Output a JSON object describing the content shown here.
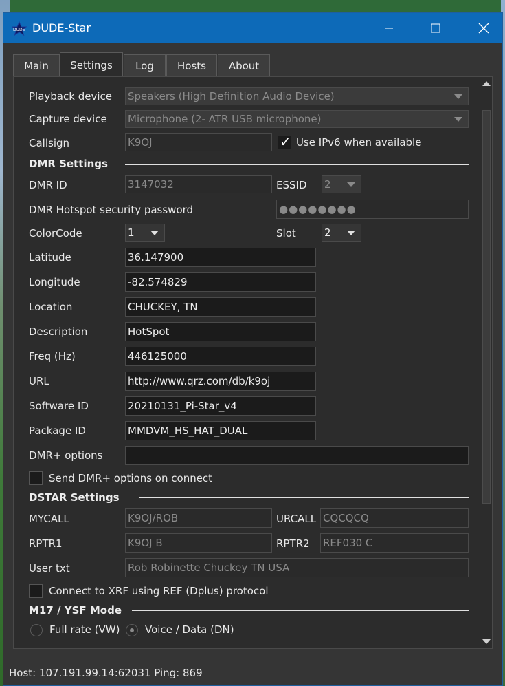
{
  "window": {
    "title": "DUDE-Star",
    "icon": "dude-star-icon"
  },
  "colors": {
    "titlebar": "#0d6ab8",
    "panel": "#2c2c2c",
    "enabled_field": "#1b1b1b"
  },
  "tabs": [
    {
      "label": "Main"
    },
    {
      "label": "Settings",
      "active": true
    },
    {
      "label": "Log"
    },
    {
      "label": "Hosts"
    },
    {
      "label": "About"
    }
  ],
  "settings": {
    "playback_label": "Playback device",
    "playback_value": "Speakers (High Definition Audio Device)",
    "capture_label": "Capture device",
    "capture_value": "Microphone (2- ATR USB microphone)",
    "callsign_label": "Callsign",
    "callsign_value": "K9OJ",
    "ipv6_label": "Use IPv6 when available",
    "ipv6_checked": true
  },
  "dmr": {
    "section": "DMR Settings",
    "id_label": "DMR ID",
    "id_value": "3147032",
    "essid_label": "ESSID",
    "essid_value": "2",
    "password_label": "DMR Hotspot security password",
    "password_value": "●●●●●●●●",
    "colorcode_label": "ColorCode",
    "colorcode_value": "1",
    "slot_label": "Slot",
    "slot_value": "2",
    "latitude_label": "Latitude",
    "latitude_value": "36.147900",
    "longitude_label": "Longitude",
    "longitude_value": "-82.574829",
    "location_label": "Location",
    "location_value": "CHUCKEY, TN",
    "description_label": "Description",
    "description_value": "HotSpot",
    "freq_label": "Freq (Hz)",
    "freq_value": "446125000",
    "url_label": "URL",
    "url_value": "http://www.qrz.com/db/k9oj",
    "software_label": "Software ID",
    "software_value": "20210131_Pi-Star_v4",
    "package_label": "Package ID",
    "package_value": "MMDVM_HS_HAT_DUAL",
    "options_label": "DMR+ options",
    "options_value": "",
    "send_options_label": "Send DMR+ options on connect",
    "send_options_checked": false
  },
  "dstar": {
    "section": "DSTAR Settings",
    "mycall_label": "MYCALL",
    "mycall_value": "K9OJ/ROB",
    "urcall_label": "URCALL",
    "urcall_value": "CQCQCQ",
    "rptr1_label": "RPTR1",
    "rptr1_value": "K9OJ B",
    "rptr2_label": "RPTR2",
    "rptr2_value": "REF030 C",
    "usertxt_label": "User txt",
    "usertxt_value": "Rob Robinette Chuckey TN USA",
    "xrf_label": "Connect to XRF using REF (Dplus) protocol",
    "xrf_checked": false
  },
  "m17": {
    "section": "M17 / YSF Mode",
    "full_rate_label": "Full rate (VW)",
    "voice_data_label": "Voice / Data (DN)",
    "selected": "Voice / Data (DN)"
  },
  "status": {
    "text": "Host: 107.191.99.14:62031 Ping: 869"
  }
}
